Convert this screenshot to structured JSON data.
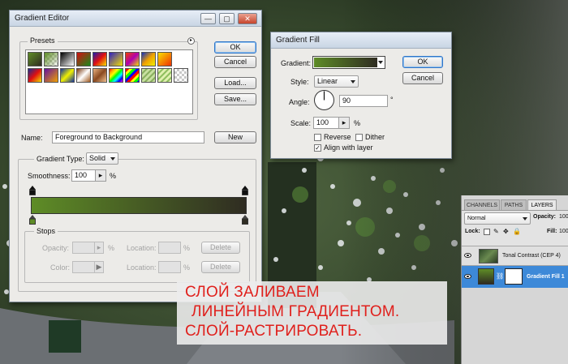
{
  "colors": {
    "red_text": "#e0201c",
    "gradient_start": "#5e8c26",
    "gradient_end": "#2f2c22",
    "accent": "#3d89d8"
  },
  "gradient_editor": {
    "title": "Gradient Editor",
    "presets_label": "Presets",
    "buttons": {
      "ok": "OK",
      "cancel": "Cancel",
      "load": "Load...",
      "save": "Save...",
      "new": "New"
    },
    "name_label": "Name:",
    "name_value": "Foreground to Background",
    "gradient_type_label": "Gradient Type:",
    "gradient_type_value": "Solid",
    "smoothness_label": "Smoothness:",
    "smoothness_value": "100",
    "percent": "%",
    "stops": {
      "title": "Stops",
      "opacity_label": "Opacity:",
      "location_label": "Location:",
      "color_label": "Color:",
      "delete_label": "Delete"
    }
  },
  "gradient_fill": {
    "title": "Gradient Fill",
    "gradient_label": "Gradient:",
    "style_label": "Style:",
    "style_value": "Linear",
    "angle_label": "Angle:",
    "angle_value": "90",
    "degree": "°",
    "scale_label": "Scale:",
    "scale_value": "100",
    "percent": "%",
    "reverse_label": "Reverse",
    "dither_label": "Dither",
    "align_label": "Align with layer",
    "align_checked": true,
    "buttons": {
      "ok": "OK",
      "cancel": "Cancel"
    }
  },
  "layers_panel": {
    "tabs": [
      "CHANNELS",
      "PATHS",
      "LAYERS"
    ],
    "blend_mode": "Normal",
    "opacity_label": "Opacity:",
    "opacity_value": "100",
    "lock_label": "Lock:",
    "fill_label": "Fill:",
    "fill_value": "100",
    "layers": [
      {
        "name": "Tonal Contrast (CEP 4)",
        "selected": false
      },
      {
        "name": "Gradient Fill 1",
        "selected": true
      }
    ]
  },
  "caption": {
    "line1": "СЛОЙ ЗАЛИВАЕМ",
    "line2": "ЛИНЕЙНЫМ ГРАДИЕНТОМ.",
    "line3": "СЛОЙ-РАСТРИРОВАТЬ."
  }
}
